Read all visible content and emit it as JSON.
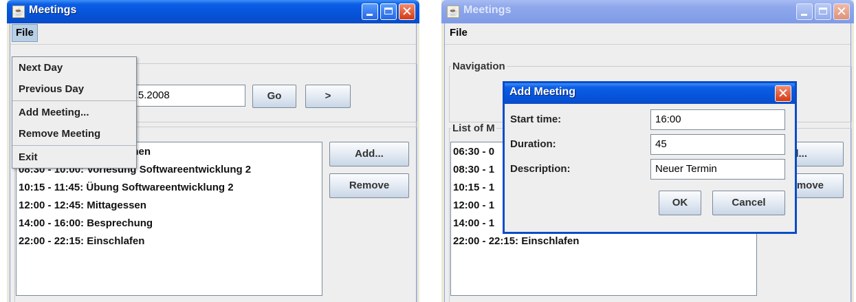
{
  "colors": {
    "title_active": "#0553d8",
    "title_inactive": "#8fa8ec",
    "close_button": "#d33a14",
    "menu_highlight": "#b8cfe5"
  },
  "left_window": {
    "title": "Meetings",
    "menubar": {
      "file_label": "File"
    },
    "file_menu": {
      "items": [
        "Next Day",
        "Previous Day",
        "Add Meeting...",
        "Remove Meeting",
        "Exit"
      ]
    },
    "navigation": {
      "date_value": "15.5.2008",
      "go_label": "Go",
      "next_label": ">"
    },
    "list_items": [
      "chen",
      "08:30 - 10:00: Vorlesung Softwareentwicklung 2",
      "10:15 - 11:45: Übung Softwareentwicklung 2",
      "12:00 - 12:45: Mittagessen",
      "14:00 - 16:00: Besprechung",
      "22:00 - 22:15: Einschlafen"
    ],
    "add_label": "Add...",
    "remove_label": "Remove"
  },
  "right_window": {
    "title": "Meetings",
    "menubar": {
      "file_label": "File"
    },
    "navigation_legend": "Navigation",
    "list_legend": "List of M",
    "list_items": [
      "06:30 - 0",
      "08:30 - 1",
      "10:15 - 1",
      "12:00 - 1",
      "14:00 - 1",
      "22:00 - 22:15: Einschlafen"
    ],
    "add_label_partial": "dd...",
    "remove_label_partial": "move",
    "dialog": {
      "title": "Add Meeting",
      "start_time_label": "Start time:",
      "start_time_value": "16:00",
      "duration_label": "Duration:",
      "duration_value": "45",
      "description_label": "Description:",
      "description_value": "Neuer Termin",
      "ok_label": "OK",
      "cancel_label": "Cancel"
    }
  }
}
